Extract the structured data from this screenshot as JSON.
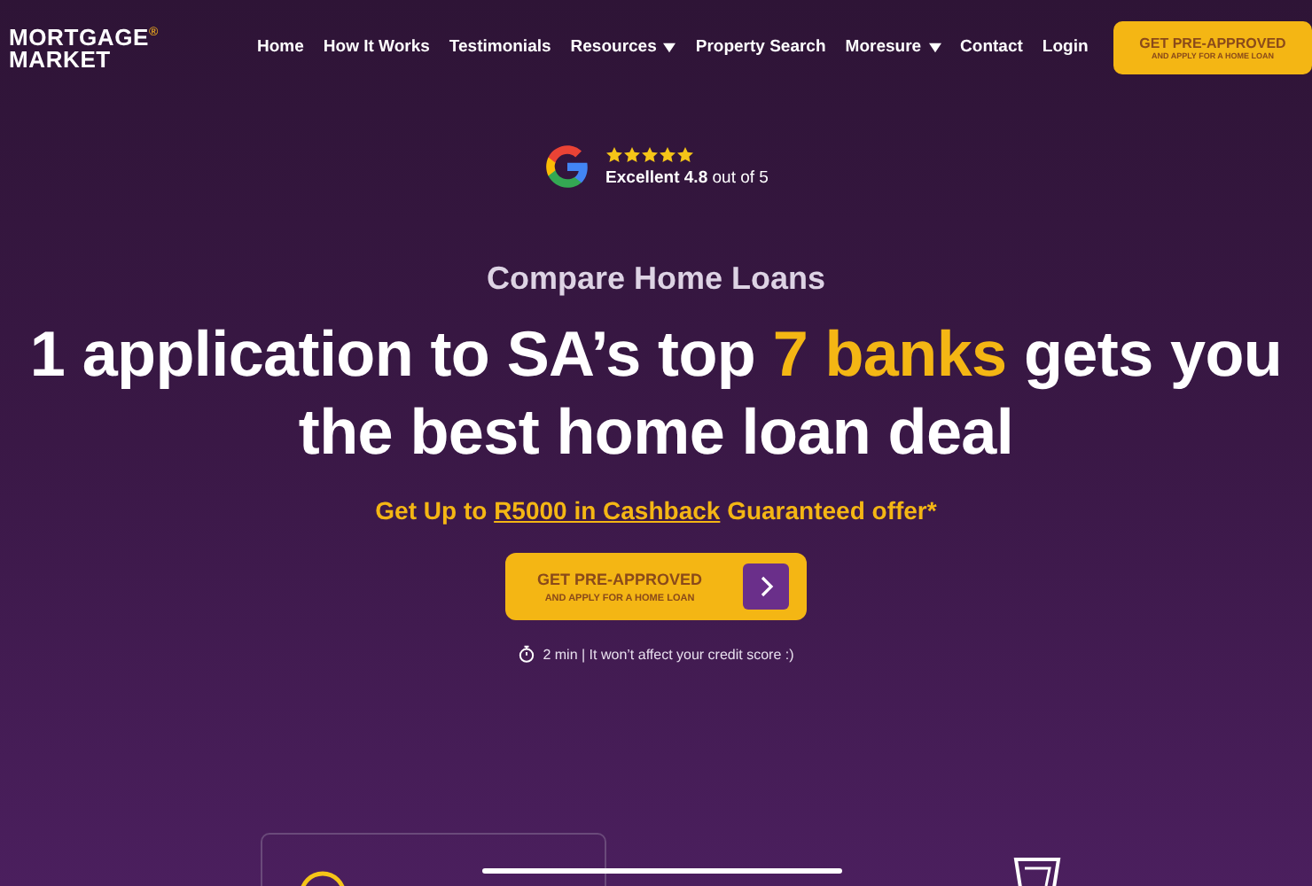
{
  "logo": {
    "line_1": "MORTGAGE",
    "line_2": "MARKET",
    "mark": "®"
  },
  "nav": [
    {
      "label": "Home",
      "dropdown": false
    },
    {
      "label": "How It Works",
      "dropdown": false
    },
    {
      "label": "Testimonials",
      "dropdown": false
    },
    {
      "label": "Resources",
      "dropdown": true
    },
    {
      "label": "Property Search",
      "dropdown": false
    },
    {
      "label": "Moresure",
      "dropdown": true
    },
    {
      "label": "Contact",
      "dropdown": false
    },
    {
      "label": "Login",
      "dropdown": false
    }
  ],
  "header_cta": {
    "title": "GET PRE-APPROVED",
    "subtitle": "AND APPLY FOR A HOME LOAN"
  },
  "rating": {
    "stars": 5,
    "text": "**Excellent 4.8** out of 5"
  },
  "hero": {
    "eyebrow": "Compare Home Loans",
    "headline_before": "1 application to SA’s top ",
    "headline_highlight": "7 banks",
    "headline_after": " gets you the best home loan deal",
    "offer_before": "Get Up to ",
    "offer_link": "R5000 in Cashback",
    "offer_after": " Guaranteed offer*"
  },
  "cta": {
    "title": "GET PRE-APPROVED",
    "subtitle": "AND APPLY FOR A HOME LOAN"
  },
  "note": "2 min | It won’t affect your credit score :)"
}
